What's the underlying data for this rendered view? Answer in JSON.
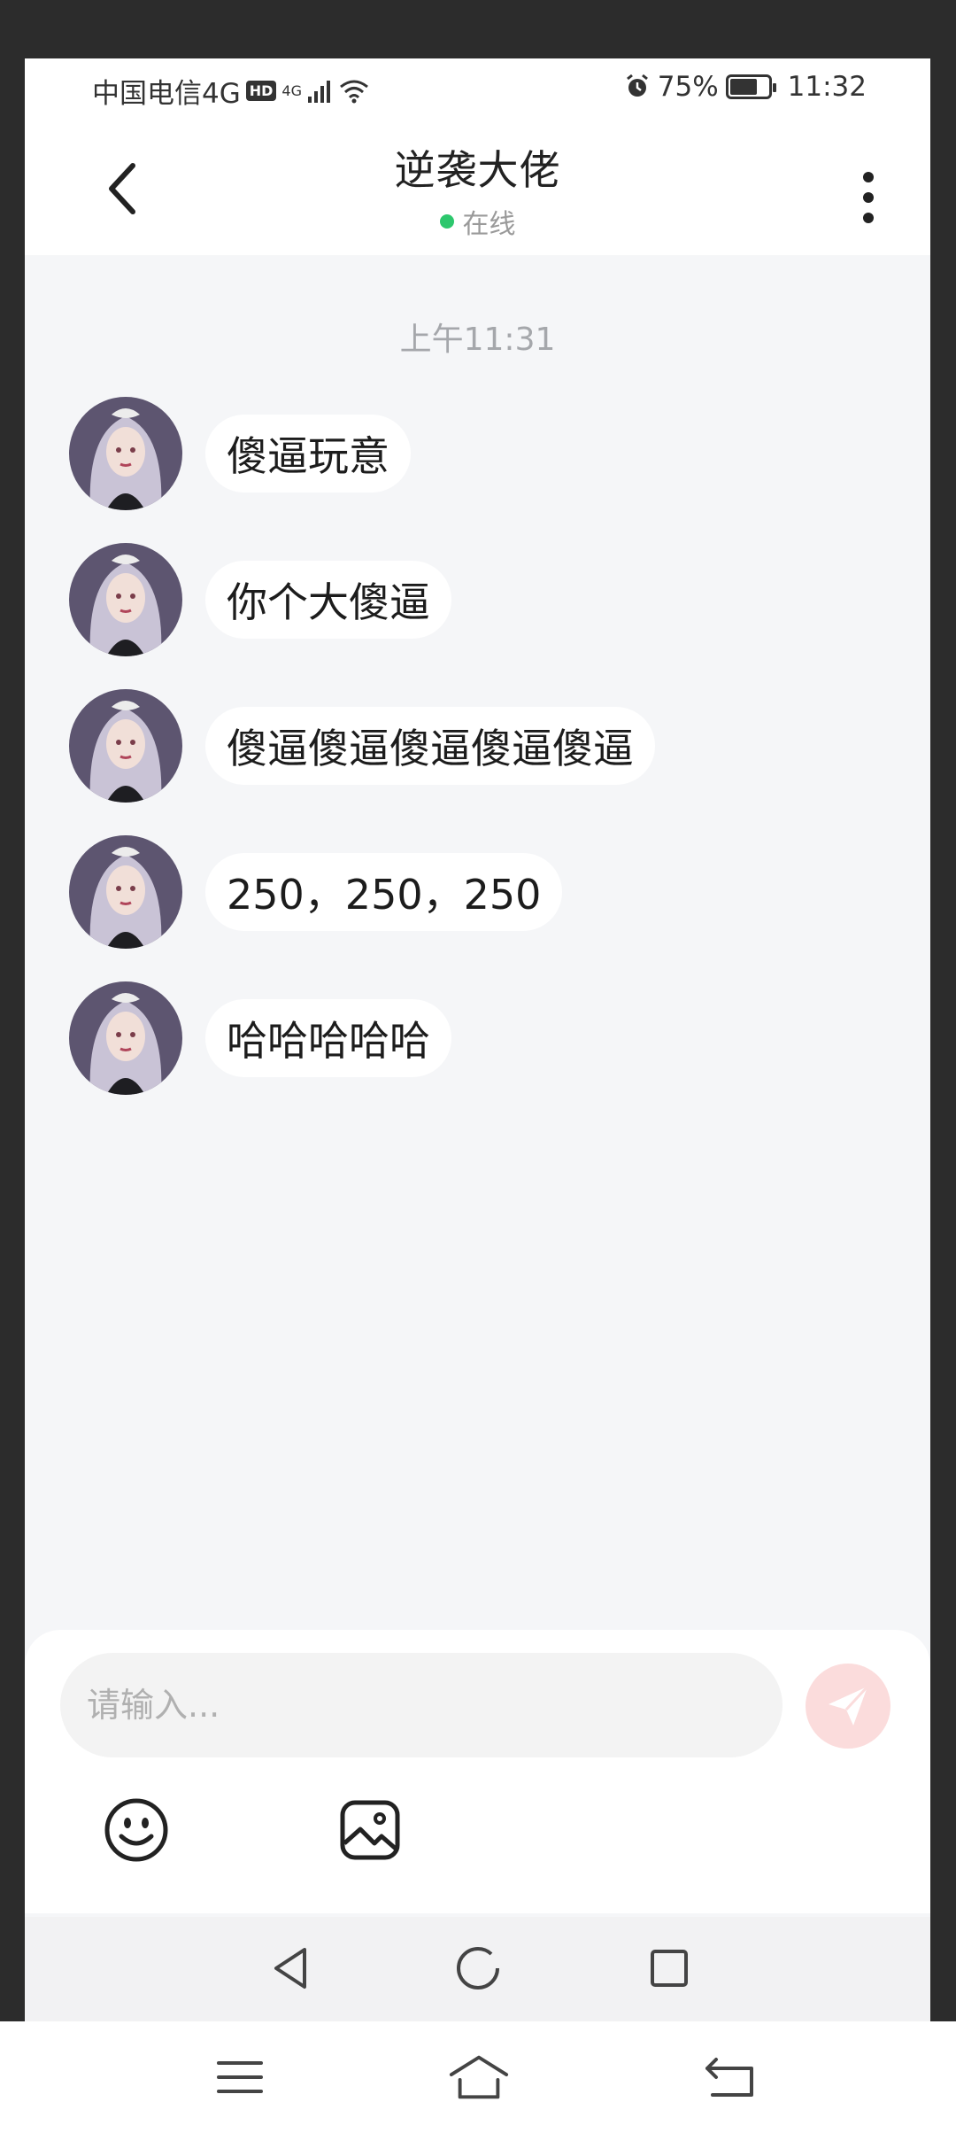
{
  "status_bar": {
    "carrier": "中国电信4G",
    "hd": "HD",
    "signal_label": "4G",
    "battery": "75%",
    "time": "11:32"
  },
  "header": {
    "title": "逆袭大佬",
    "status": "在线"
  },
  "chat": {
    "timestamp": "上午11:31",
    "messages": [
      {
        "text": "傻逼玩意"
      },
      {
        "text": "你个大傻逼"
      },
      {
        "text": "傻逼傻逼傻逼傻逼傻逼"
      },
      {
        "text": "250，250，250"
      },
      {
        "text": "哈哈哈哈哈"
      }
    ]
  },
  "composer": {
    "placeholder": "请输入..."
  },
  "icons": {
    "back": "back-arrow-icon",
    "more": "more-vertical-icon",
    "send": "send-icon",
    "emoji": "emoji-icon",
    "image": "image-icon"
  },
  "colors": {
    "online_dot": "#2dc76d",
    "send_bg": "#fbdcdc",
    "send_icon": "#ffffff",
    "chat_bg": "#f5f6f8"
  }
}
